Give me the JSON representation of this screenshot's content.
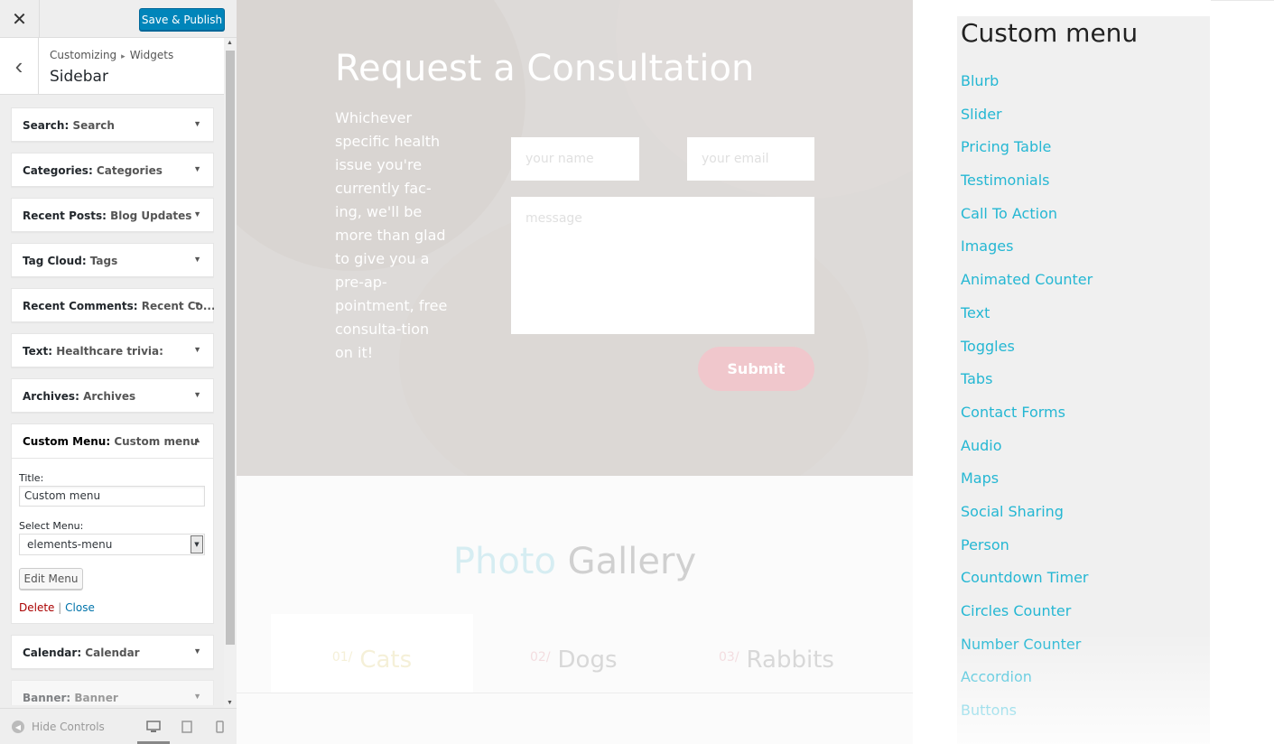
{
  "panel": {
    "close_label": "✕",
    "save_label": "Save & Publish",
    "breadcrumb": {
      "path1": "Customizing",
      "separator": "▸",
      "path2": "Widgets",
      "title": "Sidebar",
      "back_label": "‹"
    },
    "widgets": [
      {
        "type": "Search",
        "name": "Search"
      },
      {
        "type": "Categories",
        "name": "Categories"
      },
      {
        "type": "Recent Posts",
        "name": "Blog Updates"
      },
      {
        "type": "Tag Cloud",
        "name": "Tags"
      },
      {
        "type": "Recent Comments",
        "name": "Recent Co..."
      },
      {
        "type": "Text",
        "name": "Healthcare trivia:"
      },
      {
        "type": "Archives",
        "name": "Archives"
      }
    ],
    "open_widget": {
      "type": "Custom Menu",
      "name": "Custom menu",
      "title_label": "Title:",
      "title_value": "Custom menu",
      "select_label": "Select Menu:",
      "select_value": "elements-menu",
      "edit_label": "Edit Menu",
      "delete_label": "Delete",
      "divider": "|",
      "close_label": "Close"
    },
    "widgets_after": [
      {
        "type": "Calendar",
        "name": "Calendar"
      },
      {
        "type": "Banner",
        "name": "Banner"
      }
    ],
    "footer": {
      "hide_label": "Hide Controls"
    },
    "arrow_down": "▼",
    "arrow_up": "▲"
  },
  "preview": {
    "hero_title": "Request a Consultation",
    "hero_text": "Whichever specific health issue you're currently fac-ing, we'll be more than glad to give you a pre-ap-pointment, free consulta-tion on it!",
    "name_placeholder": "your name",
    "email_placeholder": "your email",
    "message_placeholder": "message",
    "submit_label": "Submit",
    "gallery_title_a": "Photo",
    "gallery_title_b": "Gallery",
    "gallery_tabs": [
      {
        "num": "01/",
        "label": "Cats"
      },
      {
        "num": "02/",
        "label": "Dogs"
      },
      {
        "num": "03/",
        "label": "Rabbits"
      }
    ],
    "sidebar": {
      "title": "Custom menu",
      "items": [
        "Blurb",
        "Slider",
        "Pricing Table",
        "Testimonials",
        "Call To Action",
        "Images",
        "Animated Counter",
        "Text",
        "Toggles",
        "Tabs",
        "Contact Forms",
        "Audio",
        "Maps",
        "Social Sharing",
        "Person",
        "Countdown Timer",
        "Circles Counter",
        "Number Counter",
        "Accordion",
        "Buttons"
      ]
    }
  },
  "colors": {
    "accent": "#0085ba",
    "link": "#25b7d3",
    "submit": "#f0c7cc"
  }
}
